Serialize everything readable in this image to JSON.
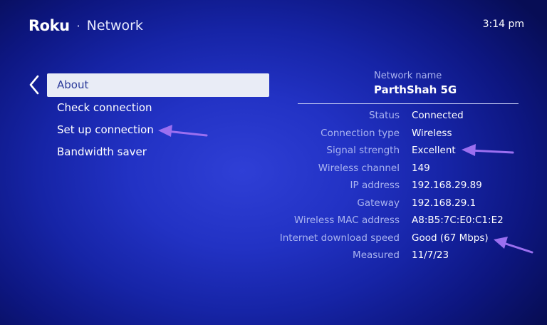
{
  "header": {
    "logo": "Roku",
    "separator": "·",
    "title": "Network",
    "time": "3:14 pm"
  },
  "menu": {
    "items": [
      {
        "label": "About",
        "selected": true
      },
      {
        "label": "Check connection",
        "selected": false
      },
      {
        "label": "Set up connection",
        "selected": false
      },
      {
        "label": "Bandwidth saver",
        "selected": false
      }
    ]
  },
  "network": {
    "name_label": "Network name",
    "name_value": "ParthShah 5G"
  },
  "details": [
    {
      "label": "Status",
      "value": "Connected"
    },
    {
      "label": "Connection type",
      "value": "Wireless"
    },
    {
      "label": "Signal strength",
      "value": "Excellent"
    },
    {
      "label": "Wireless channel",
      "value": "149"
    },
    {
      "label": "IP address",
      "value": "192.168.29.89"
    },
    {
      "label": "Gateway",
      "value": "192.168.29.1"
    },
    {
      "label": "Wireless MAC address",
      "value": "A8:B5:7C:E0:C1:E2"
    },
    {
      "label": "Internet download speed",
      "value": "Good (67 Mbps)"
    },
    {
      "label": "Measured",
      "value": "11/7/23"
    }
  ],
  "colors": {
    "background": "#1a2ab4",
    "selected_item_bg": "#e9ecf6",
    "selected_item_text": "#2b3a9a",
    "label_text": "#aab4f0",
    "annotation_arrow": "#9b6ff0"
  }
}
